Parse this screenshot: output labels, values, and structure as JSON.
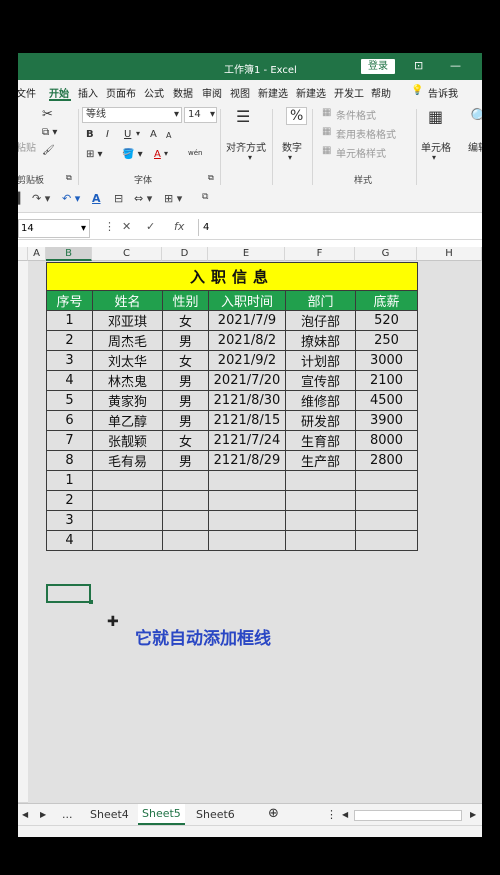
{
  "titlebar": {
    "title": "工作簿1 - Excel",
    "login": "登录"
  },
  "menu": {
    "tabs": [
      "文件",
      "开始",
      "插入",
      "页面布",
      "公式",
      "数据",
      "审阅",
      "视图",
      "新建选",
      "新建选",
      "开发工",
      "帮助",
      "告诉我"
    ],
    "active": "开始"
  },
  "ribbon": {
    "font_name": "等线",
    "font_size": "14",
    "bold": "B",
    "italic": "I",
    "underline": "U",
    "font_grow": "A",
    "font_shrink": "A",
    "font_color": "A",
    "wen": "wén",
    "align_label": "对齐方式",
    "number_label": "数字",
    "percent": "%",
    "cond_format": "条件格式",
    "table_format": "套用表格格式",
    "cell_style": "单元格样式",
    "cells_label": "单元格",
    "edit_label": "编辑",
    "paste_label": "粘贴",
    "group_clipboard": "剪贴板",
    "group_font": "字体",
    "group_style": "样式"
  },
  "formula_bar": {
    "name_box": "14",
    "cancel": "✕",
    "enter": "✓",
    "fx": "fx",
    "value": "4"
  },
  "columns": [
    "A",
    "B",
    "C",
    "D",
    "E",
    "F",
    "G",
    "H"
  ],
  "selected_column": "B",
  "table": {
    "title": "入职信息",
    "headers": [
      "序号",
      "姓名",
      "性别",
      "入职时间",
      "部门",
      "底薪"
    ],
    "rows": [
      [
        "1",
        "邓亚琪",
        "女",
        "2021/7/9",
        "泡仔部",
        "520"
      ],
      [
        "2",
        "周杰毛",
        "男",
        "2021/8/2",
        "撩妹部",
        "250"
      ],
      [
        "3",
        "刘太华",
        "女",
        "2021/9/2",
        "计划部",
        "3000"
      ],
      [
        "4",
        "林杰鬼",
        "男",
        "2021/7/20",
        "宣传部",
        "2100"
      ],
      [
        "5",
        "黄家狗",
        "男",
        "2121/8/30",
        "维修部",
        "4500"
      ],
      [
        "6",
        "单乙醇",
        "男",
        "2121/8/15",
        "研发部",
        "3900"
      ],
      [
        "7",
        "张靓颖",
        "女",
        "2121/7/24",
        "生育部",
        "8000"
      ],
      [
        "8",
        "毛有易",
        "男",
        "2121/8/29",
        "生产部",
        "2800"
      ],
      [
        "1",
        "",
        "",
        "",
        "",
        ""
      ],
      [
        "2",
        "",
        "",
        "",
        "",
        ""
      ],
      [
        "3",
        "",
        "",
        "",
        "",
        ""
      ],
      [
        "4",
        "",
        "",
        "",
        "",
        ""
      ]
    ]
  },
  "caption": "它就自动添加框线",
  "sheet_tabs": {
    "ellipsis": "...",
    "tabs": [
      "Sheet4",
      "Sheet5",
      "Sheet6"
    ],
    "active": "Sheet5",
    "add": "⊕"
  },
  "colors": {
    "excel_green": "#217346",
    "header_green": "#21a04d",
    "title_yellow": "#ffff00",
    "caption_blue": "#2a47c4"
  }
}
